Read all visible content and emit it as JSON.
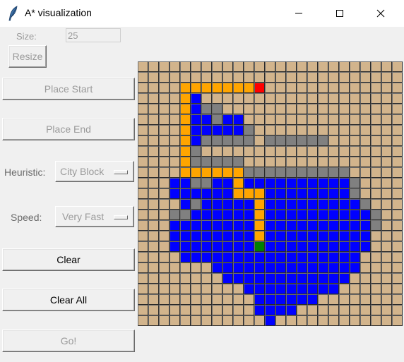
{
  "window": {
    "title": "A* visualization",
    "icons": {
      "app": "feather-icon",
      "minimize": "minimize-icon",
      "maximize": "maximize-icon",
      "close": "close-icon"
    }
  },
  "controls": {
    "size_label": "Size:",
    "size_value": "25",
    "resize_button": "Resize",
    "place_start_button": "Place Start",
    "place_end_button": "Place End",
    "heuristic_label": "Heuristic:",
    "heuristic_value": "City Block",
    "speed_label": "Speed:",
    "speed_value": "Very Fast",
    "clear_button": "Clear",
    "clear_all_button": "Clear All",
    "go_button": "Go!"
  },
  "grid": {
    "size": 25,
    "legend": {
      "empty": "#d2b48c",
      "wall": "#808080",
      "closed": "#0000ff",
      "path": "#ffa500",
      "start": "#ff0000",
      "end": "#008000"
    },
    "rows": [
      ".........................",
      ".........................",
      "....PPPPPPPS.............",
      "....PC...................",
      "....PCWW.................",
      "....PCCWCC...............",
      "....PCCCCCW..............",
      "....PCWWWWW.WWWWWW.......",
      "....PW...................",
      "....PWWWWW...............",
      "....PPPPPPWWWWWWWWWW.....",
      "...CCWWCCPCCCCCCCCCCW....",
      "...CCCCCCPPPCCCCCCCCW....",
      "....CWCCCCCPCCCCCCCCCW...",
      "...WWCCCCCCPCCCCCCCCCCW..",
      "...CCCCCCCCPCCCCCCCCCCW..",
      "...CCCCCCCCPCCCCCCCCCC...",
      "...CCCCCCCCECCCCCCCCCC...",
      "....CCCCCCCCCCCCCCCCC....",
      ".......CCCCCCCCCCCCCC....",
      "........CCCCCCCCCCCC.....",
      "..........CCCCCCCCC......",
      "...........CCCCCC........",
      "...........CCCC..........",
      "............C............"
    ]
  }
}
